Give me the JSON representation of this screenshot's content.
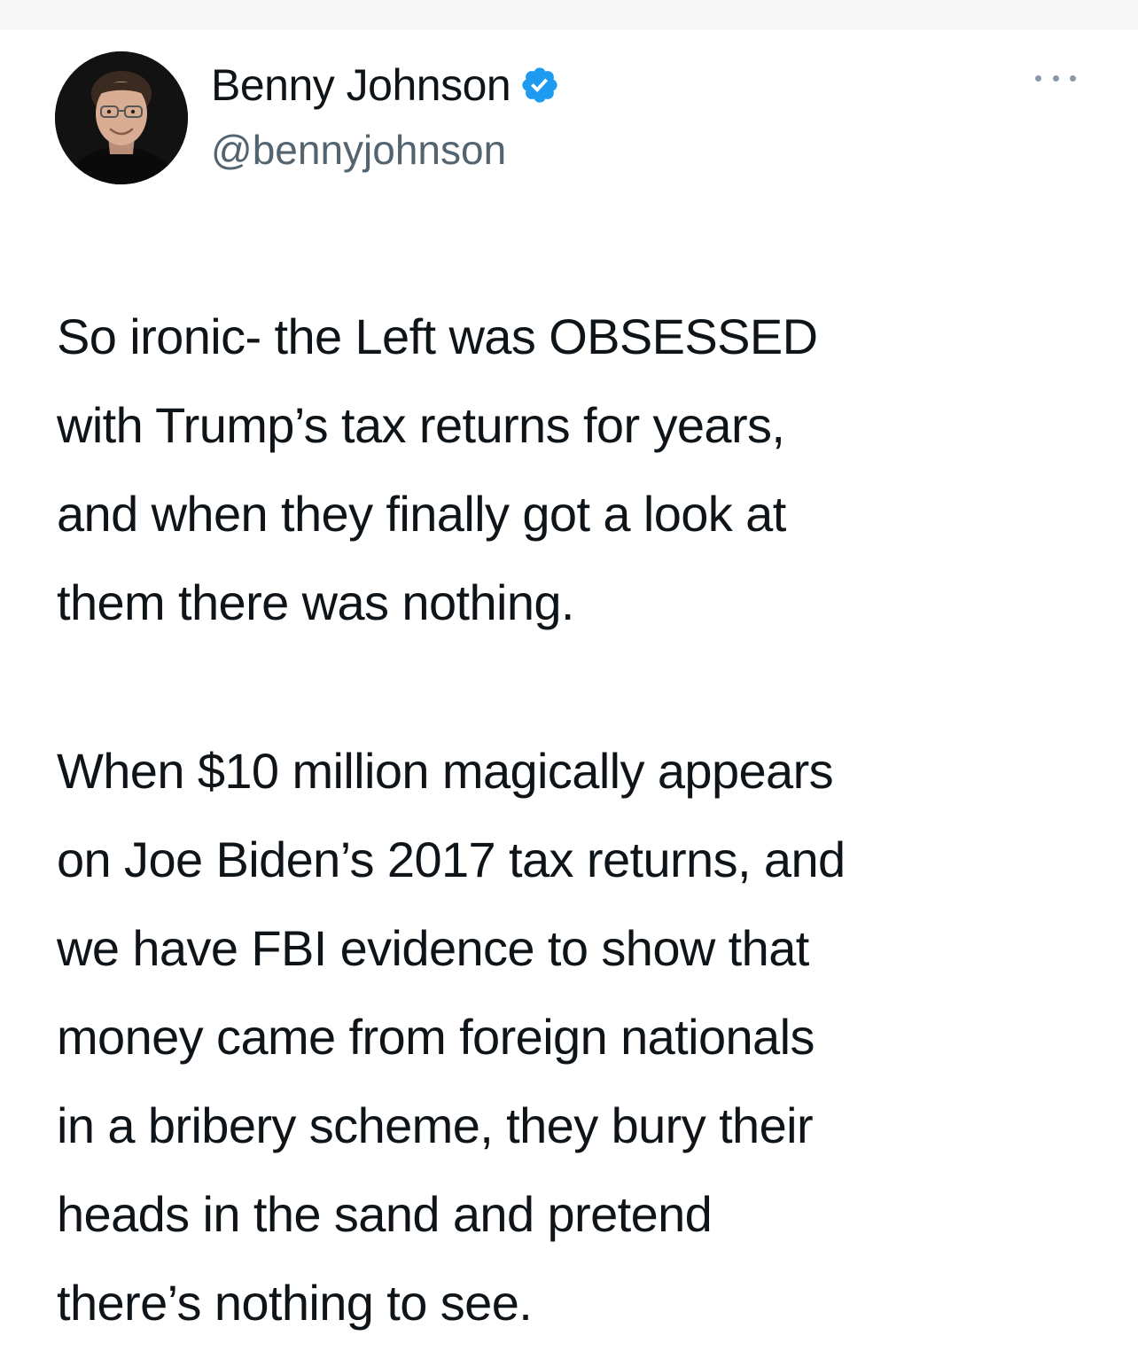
{
  "tweet": {
    "author": {
      "display_name": "Benny Johnson",
      "handle": "@bennyjohnson",
      "verified": true,
      "avatar_icon": "profile-photo",
      "verified_icon": "verified-badge-icon"
    },
    "menu_icon": "more-options-icon",
    "text": {
      "paragraph1": [
        "So ironic- the Left was OBSESSED",
        "with Trump’s tax returns for years,",
        "and when they finally got a look at",
        "them there was nothing."
      ],
      "paragraph2": [
        "When $10 million magically appears",
        "on Joe Biden’s 2017 tax returns, and",
        "we have FBI evidence to show that",
        "money came from foreign nationals",
        "in a bribery scheme, they bury their",
        "heads in the sand and pretend",
        "there’s nothing to see."
      ]
    }
  },
  "colors": {
    "text": "#0f1419",
    "secondary_text": "#536471",
    "verified_blue": "#1d9bf0",
    "background": "#ffffff"
  }
}
